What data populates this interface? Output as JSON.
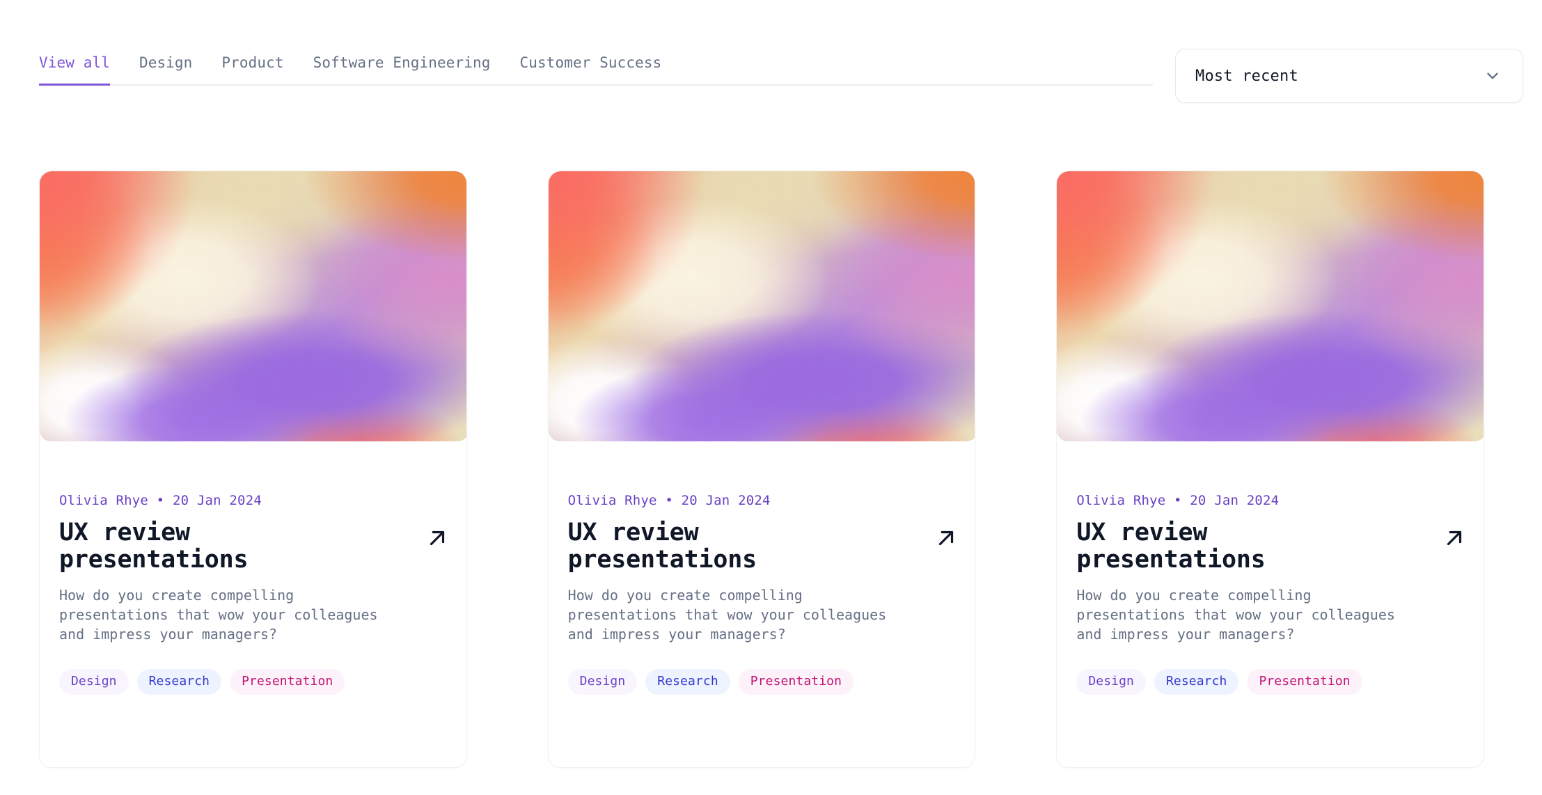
{
  "header": {
    "tabs": [
      {
        "label": "View all",
        "active": true
      },
      {
        "label": "Design",
        "active": false
      },
      {
        "label": "Product",
        "active": false
      },
      {
        "label": "Software Engineering",
        "active": false
      },
      {
        "label": "Customer Success",
        "active": false
      }
    ],
    "sort": {
      "value": "Most recent",
      "icon": "chevron-down-icon"
    }
  },
  "colors": {
    "accent_purple": "#7F56D9",
    "meta_purple": "#6941C6",
    "tab_inactive": "#667085",
    "title_dark": "#101828",
    "body_gray": "#667085",
    "card_border": "#F1F1F3",
    "divider": "#EAECF0"
  },
  "cards": [
    {
      "thumbnail": "gradient-mesh-image",
      "author": "Olivia Rhye",
      "separator": "•",
      "date": "20 Jan 2024",
      "meta": "Olivia Rhye • 20 Jan 2024",
      "title": "UX review presentations",
      "link_icon": "arrow-up-right-icon",
      "description": "How do you create compelling presentations that wow your colleagues and impress your managers?",
      "tags": [
        {
          "label": "Design",
          "color": "#6941C6",
          "bg": "#F9F5FF"
        },
        {
          "label": "Research",
          "color": "#3538CD",
          "bg": "#EEF4FF"
        },
        {
          "label": "Presentation",
          "color": "#C11574",
          "bg": "#FDF2FA"
        }
      ]
    },
    {
      "thumbnail": "gradient-mesh-image",
      "author": "Olivia Rhye",
      "separator": "•",
      "date": "20 Jan 2024",
      "meta": "Olivia Rhye • 20 Jan 2024",
      "title": "UX review presentations",
      "link_icon": "arrow-up-right-icon",
      "description": "How do you create compelling presentations that wow your colleagues and impress your managers?",
      "tags": [
        {
          "label": "Design",
          "color": "#6941C6",
          "bg": "#F9F5FF"
        },
        {
          "label": "Research",
          "color": "#3538CD",
          "bg": "#EEF4FF"
        },
        {
          "label": "Presentation",
          "color": "#C11574",
          "bg": "#FDF2FA"
        }
      ]
    },
    {
      "thumbnail": "gradient-mesh-image",
      "author": "Olivia Rhye",
      "separator": "•",
      "date": "20 Jan 2024",
      "meta": "Olivia Rhye • 20 Jan 2024",
      "title": "UX review presentations",
      "link_icon": "arrow-up-right-icon",
      "description": "How do you create compelling presentations that wow your colleagues and impress your managers?",
      "tags": [
        {
          "label": "Design",
          "color": "#6941C6",
          "bg": "#F9F5FF"
        },
        {
          "label": "Research",
          "color": "#3538CD",
          "bg": "#EEF4FF"
        },
        {
          "label": "Presentation",
          "color": "#C11574",
          "bg": "#FDF2FA"
        }
      ]
    }
  ]
}
